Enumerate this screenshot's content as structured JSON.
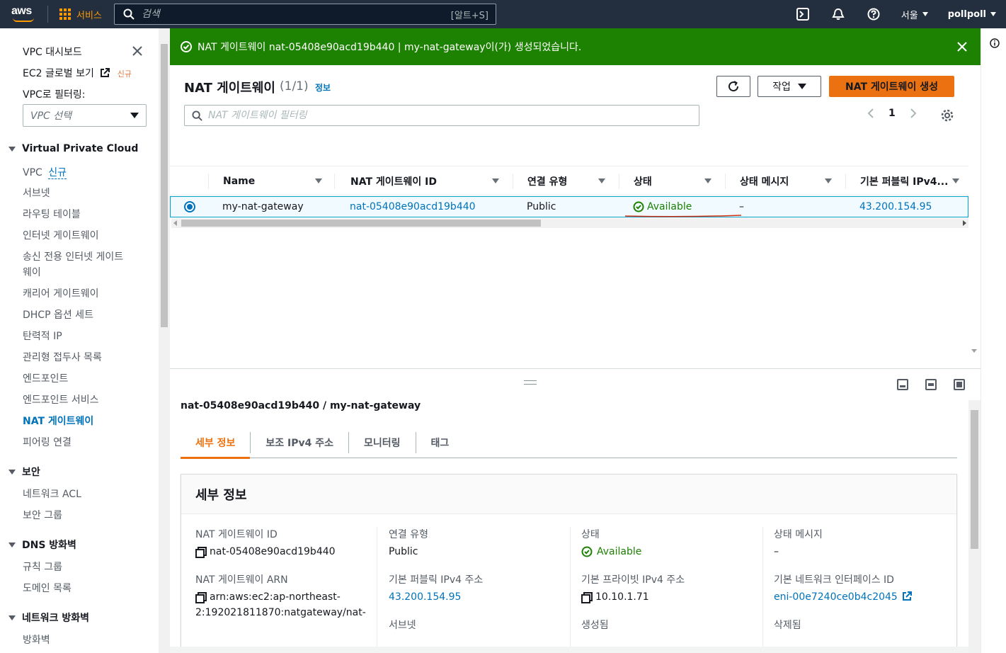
{
  "topnav": {
    "logo": "aws",
    "services_label": "서비스",
    "search_placeholder": "검색",
    "search_shortcut": "[알트+S]",
    "region": "서울",
    "user": "pollpoll"
  },
  "sidebar": {
    "dashboard": "VPC 대시보드",
    "ec2_global": "EC2 글로벌 보기",
    "ec2_global_badge": "신규",
    "filter_label": "VPC로 필터링:",
    "vpc_select_placeholder": "VPC 선택",
    "sections": [
      {
        "title": "Virtual Private Cloud",
        "items": [
          "VPC",
          "서브넷",
          "라우팅 테이블",
          "인터넷 게이트웨이",
          "송신 전용 인터넷 게이트",
          "웨이",
          "캐리어 게이트웨이",
          "DHCP 옵션 세트",
          "탄력적 IP",
          "관리형 접두사 목록",
          "엔드포인트",
          "엔드포인트 서비스",
          "NAT 게이트웨이",
          "피어링 연결"
        ],
        "vpc_badge": "신규"
      },
      {
        "title": "보안",
        "items": [
          "네트워크 ACL",
          "보안 그룹"
        ]
      },
      {
        "title": "DNS 방화벽",
        "items": [
          "규칙 그룹",
          "도메인 목록"
        ]
      },
      {
        "title": "네트워크 방화벽",
        "items": [
          "방화벽"
        ]
      }
    ]
  },
  "flash": {
    "message": "NAT 게이트웨이 nat-05408e90acd19b440 | my-nat-gateway이(가) 생성되었습니다."
  },
  "table_panel": {
    "title": "NAT 게이트웨이",
    "count": "(1/1)",
    "info": "정보",
    "actions_label": "작업",
    "create_label": "NAT 게이트웨이 생성",
    "filter_placeholder": "NAT 게이트웨이 필터링",
    "page": "1",
    "columns": [
      "Name",
      "NAT 게이트웨이 ID",
      "연결 유형",
      "상태",
      "상태 메시지",
      "기본 퍼블릭 IPv4..."
    ],
    "row": {
      "name": "my-nat-gateway",
      "id": "nat-05408e90acd19b440",
      "connectivity": "Public",
      "state": "Available",
      "state_message": "–",
      "public_ip": "43.200.154.95"
    }
  },
  "detail": {
    "title": "nat-05408e90acd19b440 / my-nat-gateway",
    "tabs": [
      "세부 정보",
      "보조 IPv4 주소",
      "모니터링",
      "태그"
    ],
    "box_title": "세부 정보",
    "col1": {
      "id_label": "NAT 게이트웨이 ID",
      "id_value": "nat-05408e90acd19b440",
      "arn_label": "NAT 게이트웨이 ARN",
      "arn_value_1": "arn:aws:ec2:ap-northeast-",
      "arn_value_2": "2:192021811870:natgateway/nat-"
    },
    "col2": {
      "conn_label": "연결 유형",
      "conn_value": "Public",
      "pub_label": "기본 퍼블릭 IPv4 주소",
      "pub_value": "43.200.154.95",
      "next_label": "서브넷"
    },
    "col3": {
      "state_label": "상태",
      "state_value": "Available",
      "priv_label": "기본 프라이빗 IPv4 주소",
      "priv_value": "10.10.1.71",
      "next_label": "생성됨"
    },
    "col4": {
      "msg_label": "상태 메시지",
      "msg_value": "–",
      "eni_label": "기본 네트워크 인터페이스 ID",
      "eni_value": "eni-00e7240ce0b4c2045",
      "next_label": "삭제됨"
    }
  },
  "colors": {
    "nav_bg": "#232f3e",
    "accent_orange": "#ec7211",
    "success_green": "#1d8102",
    "link_blue": "#0073bb"
  }
}
